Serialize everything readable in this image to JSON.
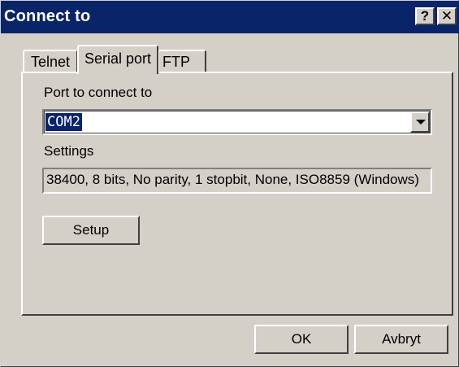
{
  "window": {
    "title": "Connect to",
    "help_label": "?",
    "close_label": "✕"
  },
  "tabs": [
    {
      "label": "Telnet",
      "selected": false
    },
    {
      "label": "Serial port",
      "selected": true
    },
    {
      "label": "FTP",
      "selected": false
    }
  ],
  "serial": {
    "port_label": "Port to connect to",
    "port_value": "COM2",
    "settings_label": "Settings",
    "settings_value": "38400, 8 bits, No parity, 1 stopbit, None, ISO8859 (Windows)",
    "setup_label": "Setup"
  },
  "footer": {
    "ok_label": "OK",
    "cancel_label": "Avbryt"
  },
  "colors": {
    "titlebar": "#0a246a",
    "face": "#d4d0c8",
    "selection": "#0a246a"
  }
}
